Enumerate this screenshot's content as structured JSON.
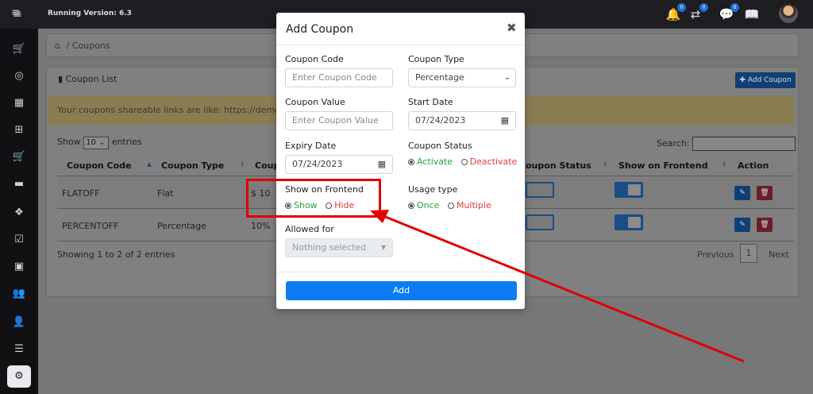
{
  "topbar": {
    "version_text": "Running Version: 6.3",
    "badges": {
      "notifications": "0",
      "transfers": "0",
      "messages": "0"
    },
    "icons": [
      "bell-icon",
      "transfer-icon",
      "chat-icon",
      "language-icon"
    ]
  },
  "sidebar": {
    "icons": [
      "menu-icon",
      "cart-icon",
      "dashboard-icon",
      "calendar-icon",
      "calendar-plus-icon",
      "shopping-cart-icon",
      "briefcase-icon",
      "cubes-icon",
      "calendar-check-icon",
      "money-icon",
      "users-icon",
      "user-icon",
      "list-icon",
      "settings-icon"
    ]
  },
  "breadcrumb": {
    "current": "Coupons",
    "separator": "/"
  },
  "coupon_list": {
    "title": "Coupon List",
    "add_button": "Add Coupon",
    "notice": "Your coupons shareable links are like: https://demo.reze",
    "show_label": "Show",
    "show_value": "10",
    "entries_label": "entries",
    "search_label": "Search:",
    "columns": [
      "Coupon Code",
      "Coupon Type",
      "Coup",
      "oupon Status",
      "Show on Frontend",
      "Action"
    ],
    "rows": [
      {
        "code": "FLATOFF",
        "type": "Flat",
        "value": "$ 10"
      },
      {
        "code": "PERCENTOFF",
        "type": "Percentage",
        "value": "10%"
      }
    ],
    "showing_text": "Showing 1 to 2 of 2 entries",
    "pager": {
      "previous": "Previous",
      "page": "1",
      "next": "Next"
    }
  },
  "modal": {
    "title": "Add Coupon",
    "close": "✖",
    "coupon_code": {
      "label": "Coupon Code",
      "placeholder": "Enter Coupon Code"
    },
    "coupon_type": {
      "label": "Coupon Type",
      "value": "Percentage"
    },
    "coupon_value": {
      "label": "Coupon Value",
      "placeholder": "Enter Coupon Value"
    },
    "start_date": {
      "label": "Start Date",
      "value": "07/24/2023"
    },
    "expiry_date": {
      "label": "Expiry Date",
      "value": "07/24/2023"
    },
    "coupon_status": {
      "label": "Coupon Status",
      "opt1": "Activate",
      "opt2": "Deactivate"
    },
    "show_frontend": {
      "label": "Show on Frontend",
      "opt1": "Show",
      "opt2": "Hide"
    },
    "usage_type": {
      "label": "Usage type",
      "opt1": "Once",
      "opt2": "Multiple"
    },
    "allowed_for": {
      "label": "Allowed for",
      "value": "Nothing selected"
    },
    "submit": "Add"
  },
  "colors": {
    "primary": "#0d7cf2",
    "success": "#22a33a",
    "danger": "#e23a3a",
    "annotation": "#e00000"
  }
}
